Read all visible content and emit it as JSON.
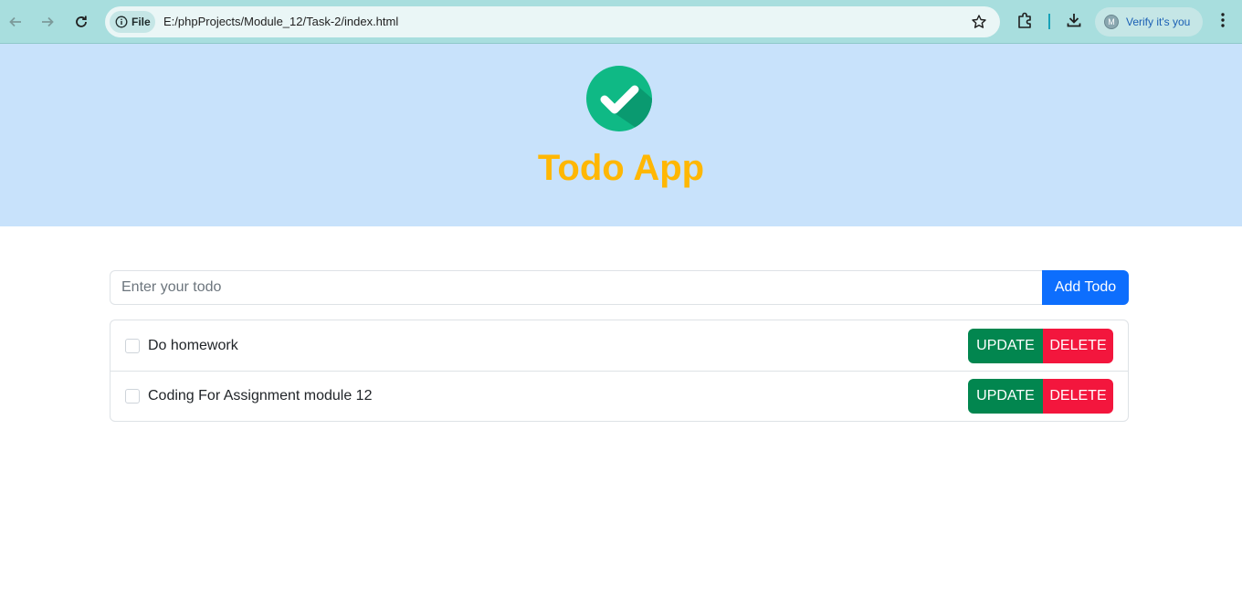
{
  "browser": {
    "file_label": "File",
    "url": "E:/phpProjects/Module_12/Task-2/index.html",
    "profile_initial": "M",
    "profile_text": "Verify it's you"
  },
  "app": {
    "title": "Todo App",
    "input_placeholder": "Enter your todo",
    "input_value": "",
    "add_button": "Add Todo"
  },
  "todos": [
    {
      "text": "Do homework",
      "checked": false,
      "update_label": "UPDATE",
      "delete_label": "DELETE"
    },
    {
      "text": "Coding For Assignment module 12",
      "checked": false,
      "update_label": "UPDATE",
      "delete_label": "DELETE"
    }
  ],
  "icons": {
    "back": "arrow-left-icon",
    "forward": "arrow-right-icon",
    "reload": "reload-icon",
    "info": "info-icon",
    "bookmark": "star-icon",
    "extensions": "puzzle-icon",
    "downloads": "download-icon",
    "menu": "kebab-menu-icon",
    "logo": "checkmark-circle-icon"
  },
  "colors": {
    "hero_bg": "#c8e2fb",
    "title": "#ffb703",
    "add": "#0d6efd",
    "update": "#02864f",
    "delete": "#f3163d",
    "logo": "#0fb985"
  }
}
